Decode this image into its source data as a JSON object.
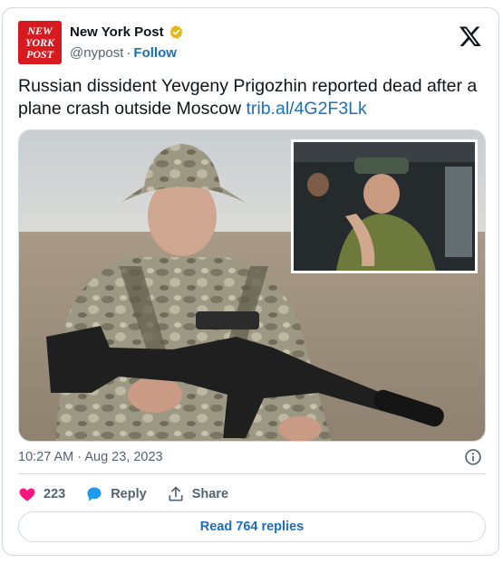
{
  "account": {
    "name": "New York Post",
    "handle": "@nypost",
    "separator": "·",
    "follow_label": "Follow",
    "avatar_lines": [
      "NEW",
      "YORK",
      "POST"
    ],
    "verified_icon": "gold-verified-badge-icon",
    "brand_color": "#d71920"
  },
  "platform_logo": "x-logo-icon",
  "tweet": {
    "text": "Russian dissident Yevgeny Prigozhin reported dead after a plane crash outside Moscow ",
    "link": "trib.al/4G2F3Lk"
  },
  "media": {
    "main": "photo-soldier-with-rifle",
    "inset": "photo-man-in-vehicle"
  },
  "meta": {
    "timestamp": "10:27 AM · Aug 23, 2023",
    "info_icon": "info-icon"
  },
  "actions": {
    "like_count": "223",
    "reply_label": "Reply",
    "share_label": "Share",
    "like_color": "#f91880",
    "reply_color": "#1d9bf0"
  },
  "read_replies_label": "Read 764 replies"
}
